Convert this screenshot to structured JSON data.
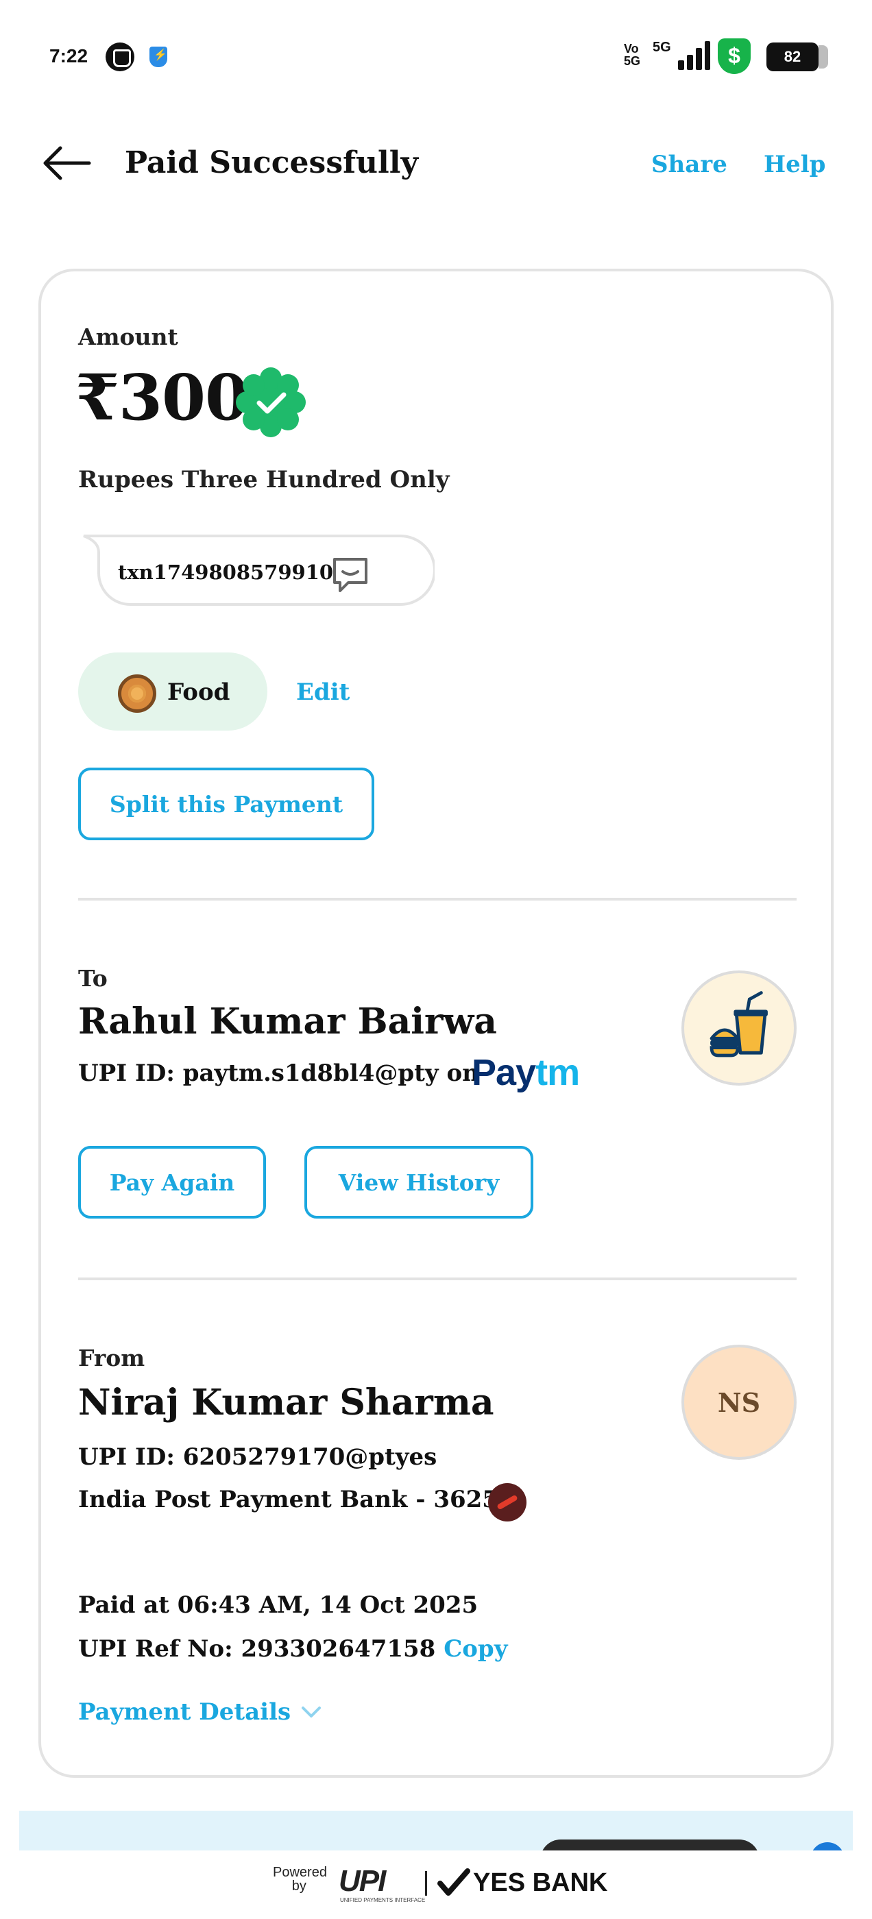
{
  "status_bar": {
    "time": "7:22",
    "volte": "Vo\n5G",
    "network": "5G",
    "battery": "82",
    "shield_symbol": "$"
  },
  "header": {
    "title": "Paid Successfully",
    "share_label": "Share",
    "help_label": "Help"
  },
  "payment": {
    "amount_label": "Amount",
    "amount_value": "₹300",
    "amount_words": "Rupees Three Hundred Only",
    "note": "txn1749808579910",
    "category": "Food",
    "edit_label": "Edit",
    "split_label": "Split this Payment"
  },
  "to": {
    "label": "To",
    "name": "Rahul Kumar Bairwa",
    "upi": "UPI ID: paytm.s1d8bl4@pty on",
    "paytm_logo_a": "Pay",
    "paytm_logo_b": "tm",
    "pay_again_label": "Pay Again",
    "view_history_label": "View History"
  },
  "from": {
    "label": "From",
    "name": "Niraj Kumar Sharma",
    "initials": "NS",
    "upi": "UPI ID: 6205279170@ptyes",
    "bank": "India Post Payment Bank - 3625"
  },
  "transaction": {
    "paid_at": "Paid at 06:43 AM, 14 Oct 2025",
    "ref_prefix": "UPI Ref No: 293302647158",
    "copy_label": "Copy",
    "details_label": "Payment Details"
  },
  "footer": {
    "powered_by_1": "Powered",
    "powered_by_2": "by",
    "upi_logo": "UPI",
    "upi_sub": "UNIFIED PAYMENTS INTERFACE",
    "bank_name": "YES BANK"
  },
  "colors": {
    "accent": "#1aa7df",
    "success": "#1fba6b",
    "category_bg": "#e4f5eb"
  }
}
